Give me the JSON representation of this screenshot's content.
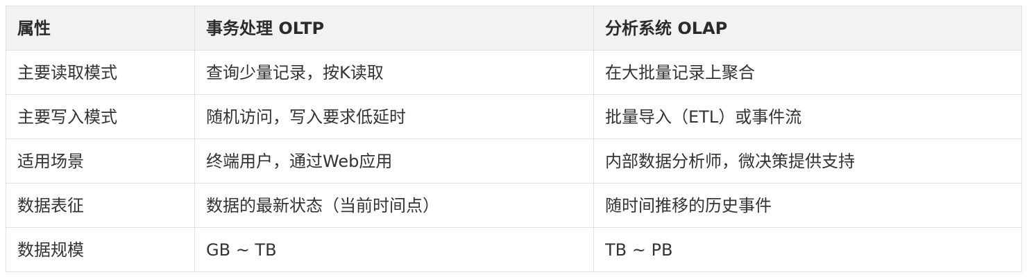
{
  "table": {
    "headers": [
      "属性",
      "事务处理 OLTP",
      "分析系统 OLAP"
    ],
    "rows": [
      [
        "主要读取模式",
        "查询少量记录，按K读取",
        "在大批量记录上聚合"
      ],
      [
        "主要写入模式",
        "随机访问，写入要求低延时",
        "批量导入（ETL）或事件流"
      ],
      [
        "适用场景",
        "终端用户，通过Web应用",
        "内部数据分析师，微决策提供支持"
      ],
      [
        "数据表征",
        "数据的最新状态（当前时间点）",
        "随时间推移的历史事件"
      ],
      [
        "数据规模",
        "GB ~ TB",
        "TB ~ PB"
      ]
    ],
    "colors": {
      "header_background": "#f2f2f2",
      "border": "#dfe2e5",
      "text": "#333333"
    }
  }
}
